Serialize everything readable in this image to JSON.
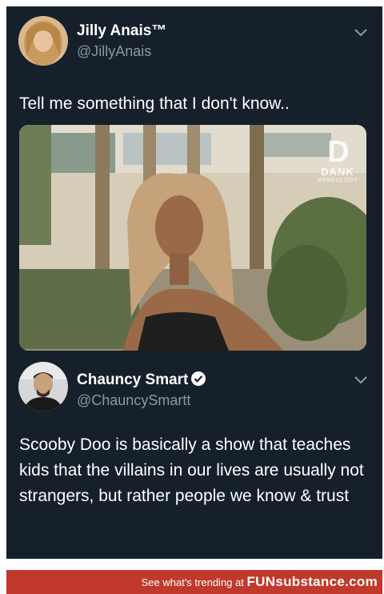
{
  "tweet1": {
    "name": "Jilly Anais™",
    "handle": "@JillyAnais",
    "text": "Tell me something that I don't know..",
    "media": {
      "watermark_logo": "D",
      "watermark_line1": "DANK",
      "watermark_line2": "MEMEOLOGY"
    }
  },
  "tweet2": {
    "name": "Chauncy Smart",
    "handle": "@ChauncySmartt",
    "verified": true,
    "text": "Scooby Doo is basically a show that teaches kids that the villains in our lives are usually not strangers, but rather people we know & trust"
  },
  "footer": {
    "prefix": "See what's trending at",
    "brand": "FUNsubstance.com"
  },
  "colors": {
    "background": "#15202b",
    "secondary_text": "#8899a6",
    "verified": "#1da1f2",
    "footer": "#c0392b"
  },
  "icons": [
    "chevron-down-icon",
    "verified-badge-icon"
  ]
}
